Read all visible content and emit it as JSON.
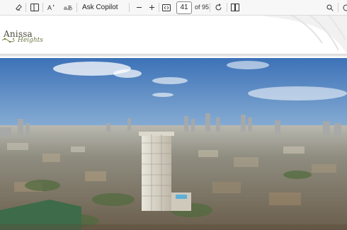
{
  "toolbar": {
    "icons": [
      "eraser-icon",
      "sidebar-toggle-icon",
      "read-aloud-icon",
      "translate-icon",
      "zoom-out-icon",
      "zoom-in-icon",
      "fit-page-icon",
      "rotate-icon",
      "page-view-icon",
      "search-icon"
    ],
    "copilot_label": "Ask Copilot",
    "current_page": "41",
    "total_pages": "of 95"
  },
  "document": {
    "logo_name": "Anissa",
    "logo_sub": "Heights"
  },
  "colors": {
    "toolbar_bg": "#f7f7f7",
    "page_bg": "#ffffff",
    "sky_top": "#3d72b8",
    "logo_green": "#6b7a45"
  }
}
